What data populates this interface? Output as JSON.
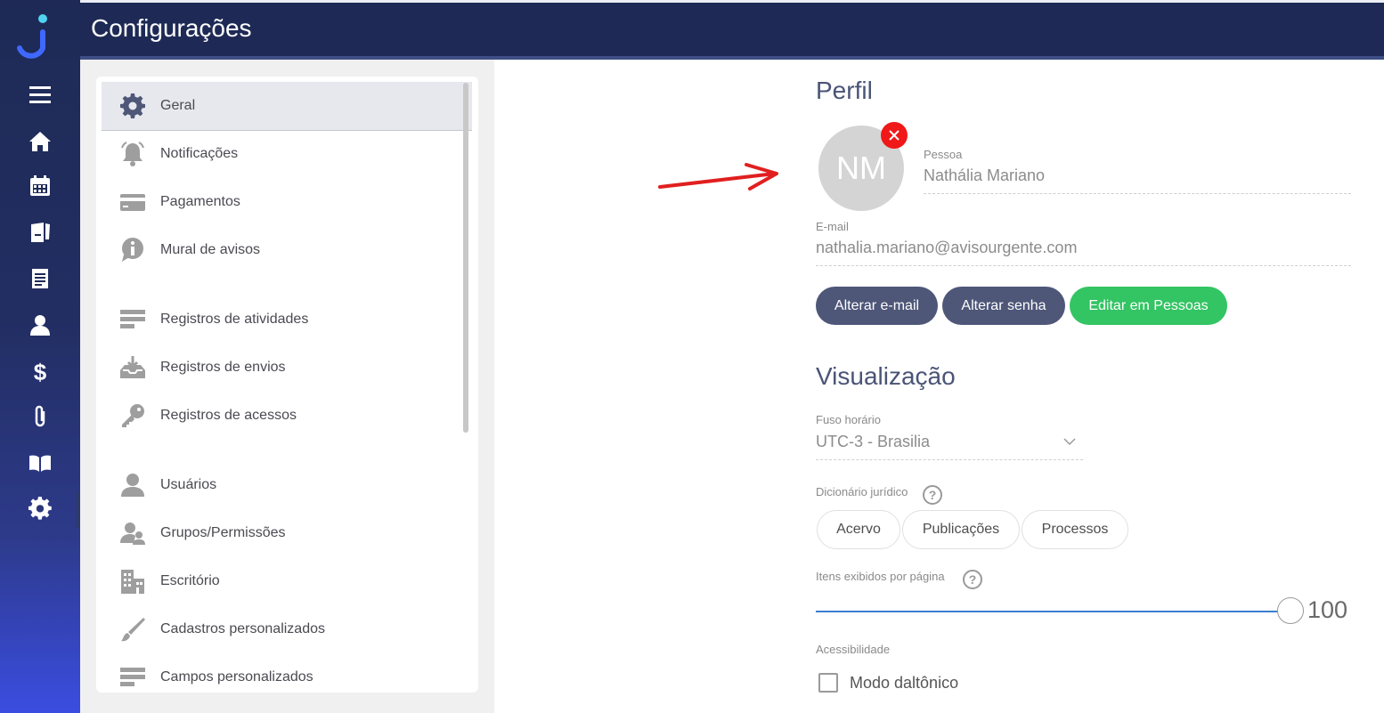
{
  "app": {
    "title": "Configurações"
  },
  "sidebar_rail": {
    "icons": [
      "menu-icon",
      "home-icon",
      "calendar-icon",
      "documents-icon",
      "file-list-icon",
      "person-icon",
      "dollar-icon",
      "paperclip-icon",
      "book-icon",
      "gear-icon"
    ]
  },
  "settings_menu": {
    "items": [
      {
        "label": "Geral",
        "icon": "gear-icon",
        "active": true
      },
      {
        "label": "Notificações",
        "icon": "bell-icon"
      },
      {
        "label": "Pagamentos",
        "icon": "credit-card-icon"
      },
      {
        "label": "Mural de avisos",
        "icon": "info-bubble-icon"
      },
      {
        "label": "Registros de atividades",
        "icon": "bars-icon"
      },
      {
        "label": "Registros de envios",
        "icon": "inbox-download-icon"
      },
      {
        "label": "Registros de acessos",
        "icon": "key-icon"
      },
      {
        "label": "Usuários",
        "icon": "user-icon"
      },
      {
        "label": "Grupos/Permissões",
        "icon": "user-group-icon"
      },
      {
        "label": "Escritório",
        "icon": "building-icon"
      },
      {
        "label": "Cadastros personalizados",
        "icon": "brush-icon"
      },
      {
        "label": "Campos personalizados",
        "icon": "bars-icon"
      }
    ]
  },
  "profile": {
    "section_title": "Perfil",
    "avatar_initials": "NM",
    "person_label": "Pessoa",
    "person_name": "Nathália Mariano",
    "email_label": "E-mail",
    "email_value": "nathalia.mariano@avisourgente.com",
    "buttons": {
      "change_email": "Alterar e-mail",
      "change_password": "Alterar senha",
      "edit_in_people": "Editar em Pessoas"
    }
  },
  "display": {
    "section_title": "Visualização",
    "timezone_label": "Fuso horário",
    "timezone_value": "UTC-3 - Brasilia",
    "dictionary_label": "Dicionário jurídico",
    "dictionary_options": [
      "Acervo",
      "Publicações",
      "Processos"
    ],
    "items_per_page_label": "Itens exibidos por página",
    "items_per_page_value": "100",
    "accessibility_label": "Acessibilidade",
    "colorblind_label": "Modo daltônico",
    "colorblind_checked": false,
    "help_glyph": "?"
  },
  "colors": {
    "header_bg": "#1e2a55",
    "primary_button": "#4e5778",
    "success_button": "#33c463",
    "remove_badge": "#f01818",
    "slider": "#3b7fd0"
  }
}
